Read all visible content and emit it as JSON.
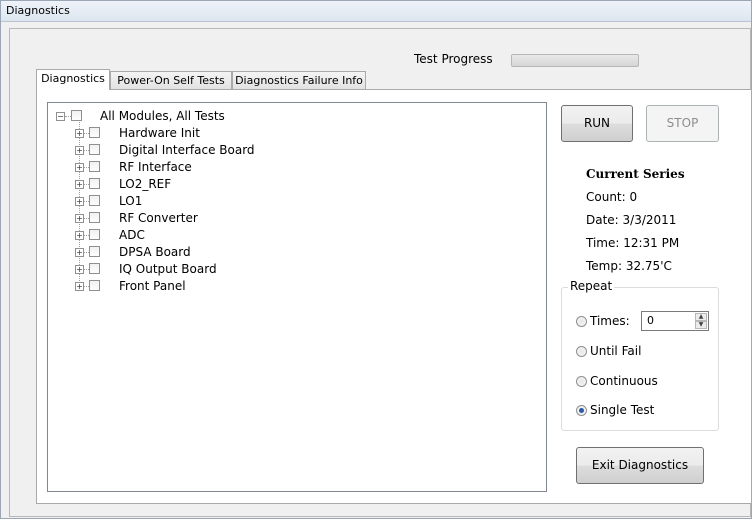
{
  "window": {
    "title": "Diagnostics"
  },
  "progress": {
    "label": "Test Progress",
    "value": 0
  },
  "tabs": [
    {
      "label": "Diagnostics",
      "active": true
    },
    {
      "label": "Power-On Self Tests",
      "active": false
    },
    {
      "label": "Diagnostics Failure Info",
      "active": false
    }
  ],
  "tree": {
    "root": {
      "label": "All Modules, All Tests",
      "expand_glyph": "−"
    },
    "children": [
      {
        "label": "Hardware Init"
      },
      {
        "label": "Digital Interface Board"
      },
      {
        "label": "RF Interface"
      },
      {
        "label": "LO2_REF"
      },
      {
        "label": "LO1"
      },
      {
        "label": "RF Converter"
      },
      {
        "label": "ADC"
      },
      {
        "label": "DPSA Board"
      },
      {
        "label": "IQ Output Board"
      },
      {
        "label": "Front Panel"
      }
    ],
    "child_expand_glyph": "+"
  },
  "buttons": {
    "run": "RUN",
    "stop": "STOP",
    "exit": "Exit Diagnostics"
  },
  "series": {
    "title": "Current Series",
    "count": "Count: 0",
    "date": "Date: 3/3/2011",
    "time": "Time: 12:31 PM",
    "temp": "Temp: 32.75'C"
  },
  "repeat": {
    "label": "Repeat",
    "times_label": "Times:",
    "times_value": "0",
    "until_fail": "Until Fail",
    "continuous": "Continuous",
    "single_test": "Single Test",
    "selected": "single_test"
  },
  "icons": {
    "spin_up": "▲",
    "spin_down": "▼"
  }
}
